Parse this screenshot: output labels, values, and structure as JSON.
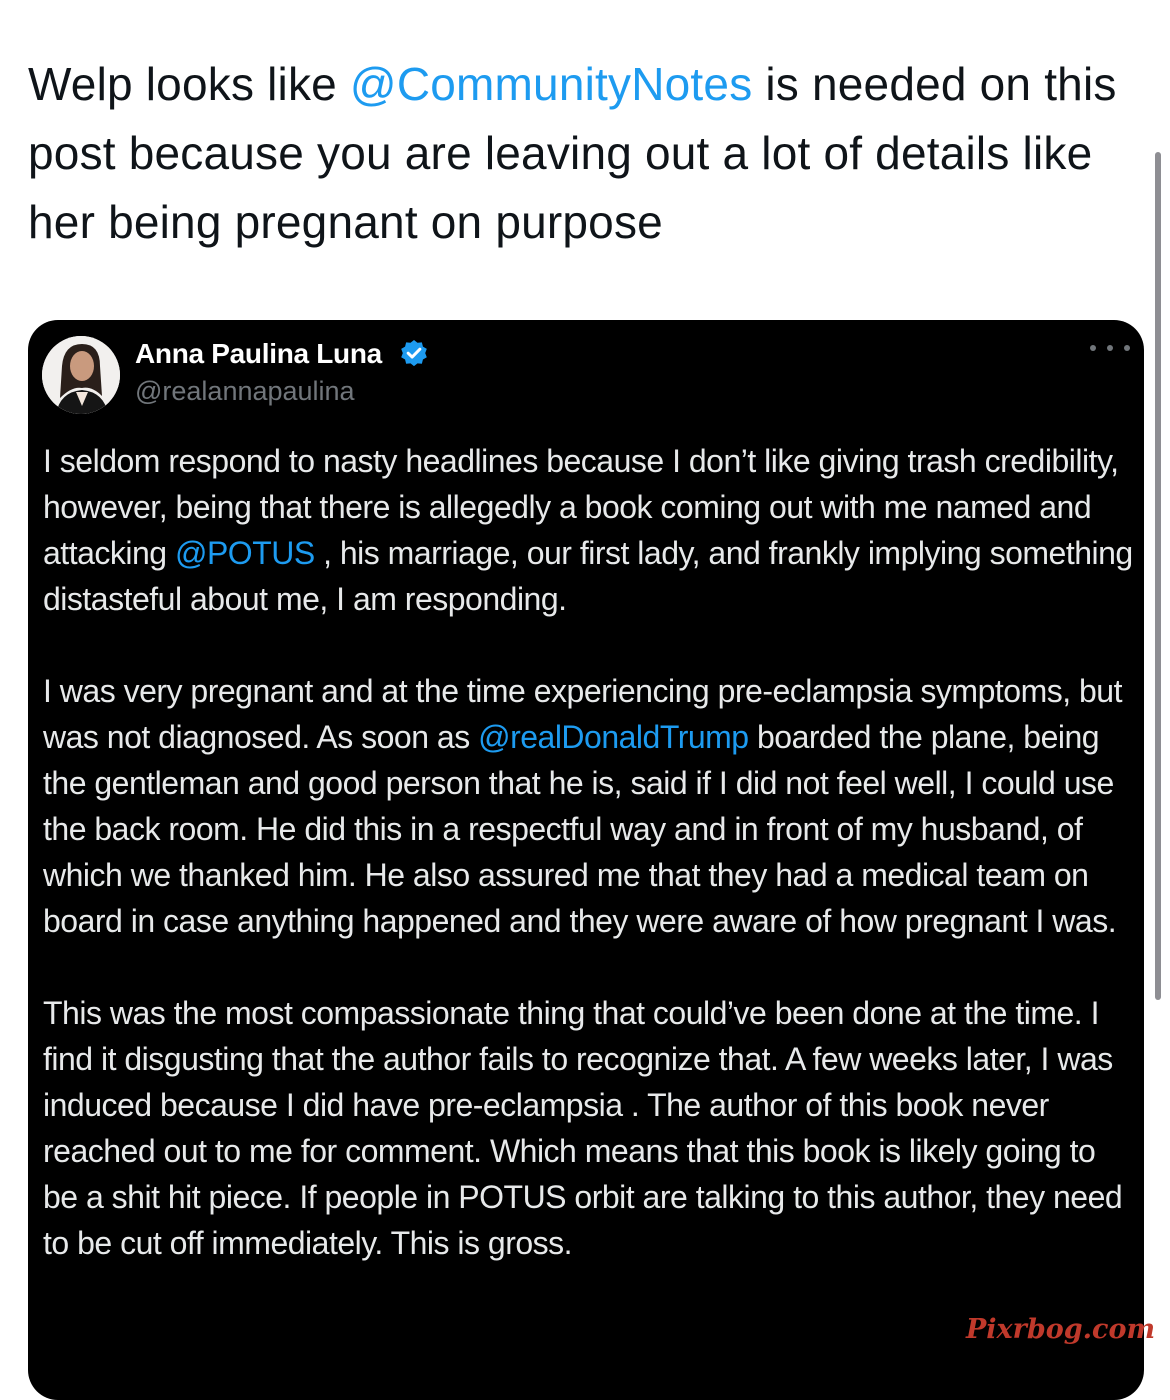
{
  "reply": {
    "text_before": "Welp looks like ",
    "mention": "@CommunityNotes",
    "text_after": " is needed on this post because you are leaving out a lot of details like her being pregnant on purpose"
  },
  "quoted_post": {
    "author_name": "Anna Paulina Luna",
    "handle": "@realannapaulina",
    "paragraph1": {
      "before": "I seldom respond to nasty headlines because I don’t like giving  trash credibility, however, being that there is allegedly a book coming out with me named and attacking ",
      "mention": "@POTUS",
      "after": " , his marriage, our first lady, and frankly implying something distasteful about me, I am responding."
    },
    "paragraph2": {
      "before": "I was very pregnant and at the time experiencing pre-eclampsia symptoms, but was not diagnosed. As soon as ",
      "mention": "@realDonaldTrump",
      "after": " boarded the plane, being the gentleman and good person that he is, said if I did not feel well, I could use the back room. He did this in a respectful way and in front of my husband, of which we thanked him. He also assured me that they had a medical team on board in case anything happened and they were aware of how pregnant I was."
    },
    "paragraph3": "This was the most compassionate thing that could’ve been done at the time.  I find it disgusting that the author fails to recognize that. A few weeks later, I was induced because I did have pre-eclampsia . The author of this book never reached out to me for comment. Which means that this book is likely going to be a shit hit piece. If people in POTUS orbit are talking to this author, they need to be cut off immediately. This is gross."
  },
  "watermark": "Pixrbog.com",
  "icons": {
    "verified": "verified-badge-icon",
    "more": "more-options-icon"
  },
  "colors": {
    "mention": "#1d9bf0",
    "card_background": "#000000",
    "verified": "#1d9bf0",
    "watermark": "#c0392b"
  }
}
